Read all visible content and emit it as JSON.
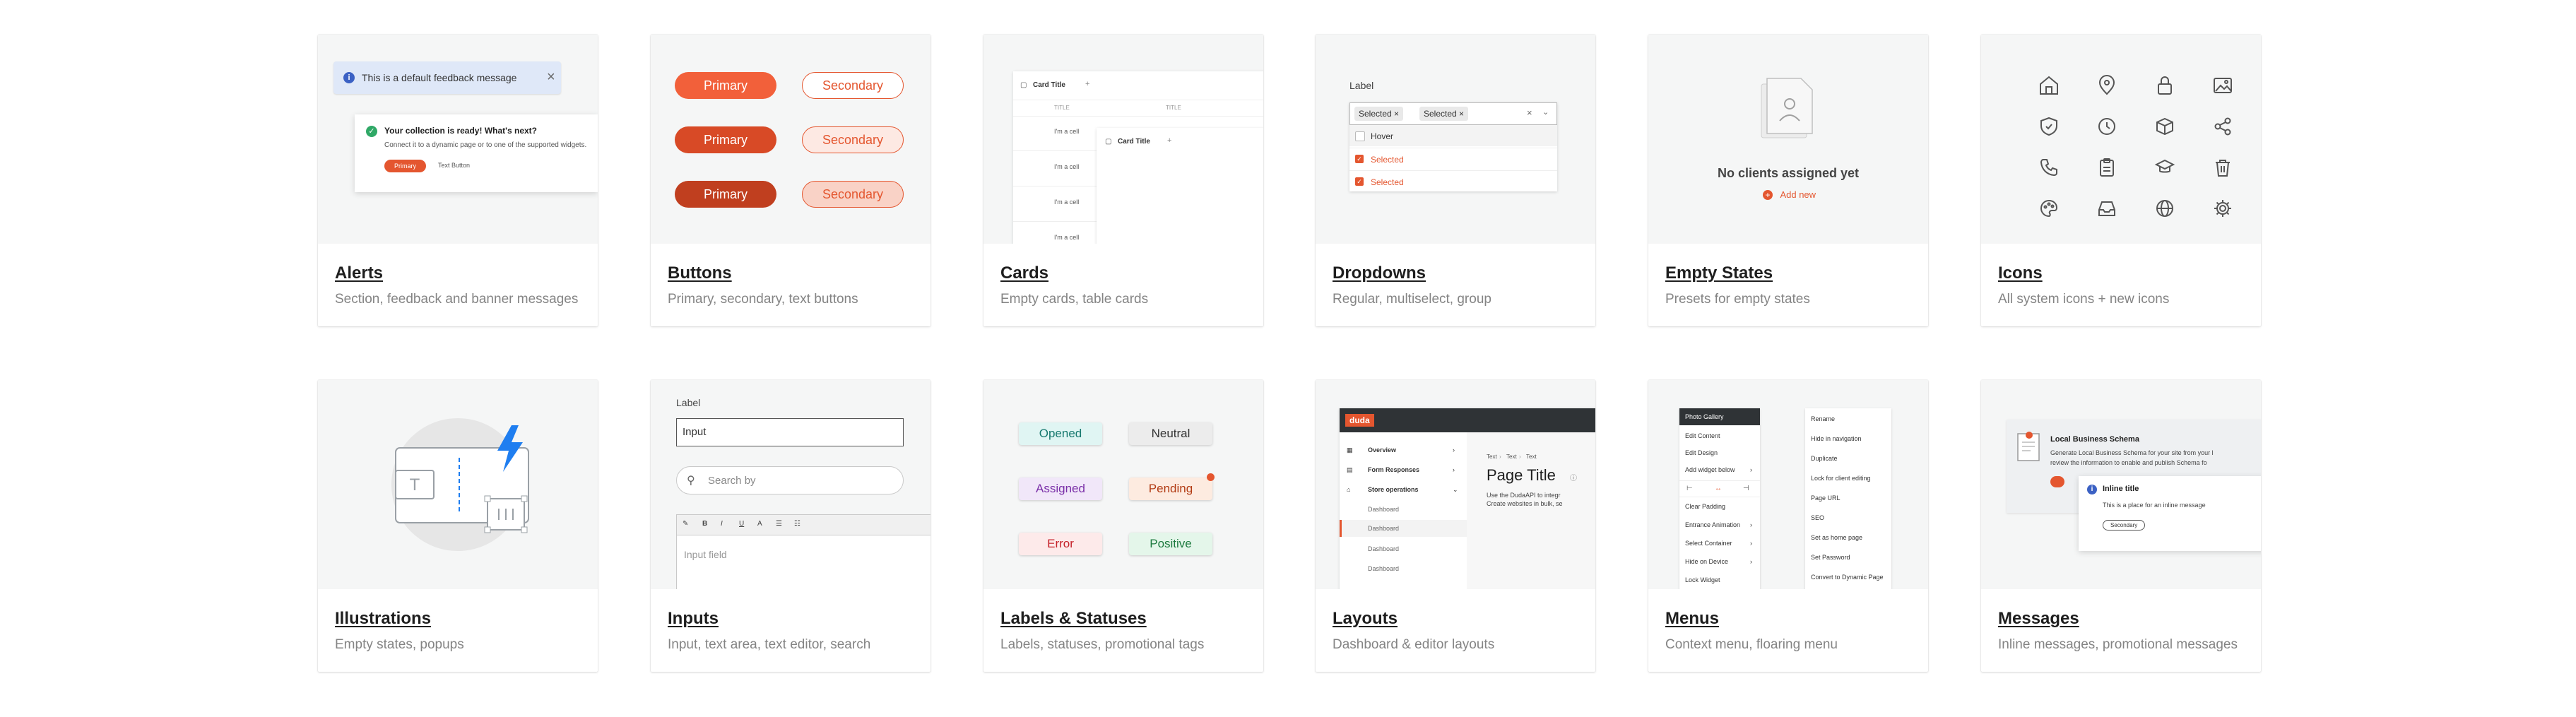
{
  "cards": [
    {
      "title": "Alerts",
      "desc": "Section, feedback and banner messages"
    },
    {
      "title": "Buttons",
      "desc": "Primary, secondary, text buttons"
    },
    {
      "title": "Cards",
      "desc": "Empty cards, table cards"
    },
    {
      "title": "Dropdowns",
      "desc": "Regular, multiselect, group"
    },
    {
      "title": "Empty States",
      "desc": "Presets for empty states"
    },
    {
      "title": "Icons",
      "desc": "All system icons + new icons"
    },
    {
      "title": "Illustrations",
      "desc": "Empty states, popups"
    },
    {
      "title": "Inputs",
      "desc": "Input, text area, text editor, search"
    },
    {
      "title": "Labels & Statuses",
      "desc": "Labels, statuses, promotional tags"
    },
    {
      "title": "Layouts",
      "desc": "Dashboard & editor layouts"
    },
    {
      "title": "Menus",
      "desc": "Context menu, floaring menu"
    },
    {
      "title": "Messages",
      "desc": "Inline messages, promotional messages"
    }
  ],
  "alerts": {
    "banner_text": "This is a default feedback message",
    "title": "Your collection is ready! What's next?",
    "body": "Connect it to a dynamic page or to one of the supported widgets.",
    "primary": "Primary",
    "text_button": "Text Button"
  },
  "buttons": {
    "primary": "Primary",
    "secondary": "Secondary"
  },
  "cards_preview": {
    "card_title": "Card Title",
    "col_title": "TITLE",
    "cell": "I'm a cell"
  },
  "dropdowns": {
    "label": "Label",
    "chip": "Selected",
    "hover": "Hover",
    "selected": "Selected"
  },
  "empty_states": {
    "title": "No clients assigned yet",
    "action": "Add new"
  },
  "inputs": {
    "label": "Label",
    "value": "Input",
    "search_placeholder": "Search by",
    "textarea_placeholder": "Input field"
  },
  "labels": {
    "opened": "Opened",
    "neutral": "Neutral",
    "assigned": "Assigned",
    "pending": "Pending",
    "error": "Error",
    "positive": "Positive"
  },
  "layouts": {
    "logo": "duda",
    "nav": [
      "Overview",
      "Form Responses",
      "Store operations",
      "Dashboard",
      "Dashboard",
      "Dashboard",
      "Dashboard"
    ],
    "breadcrumb": [
      "Text",
      "Text",
      "Text"
    ],
    "page_title": "Page Title",
    "desc1": "Use the DudaAPI to integr",
    "desc2": "Create websites in bulk, se"
  },
  "menus": {
    "left": [
      "Photo Gallery",
      "Edit Content",
      "Edit Design",
      "Add widget below",
      "Clear Padding",
      "Entrance Animation",
      "Select Container",
      "Hide on Device",
      "Lock Widget"
    ],
    "right": [
      "Rename",
      "Hide in navigation",
      "Duplicate",
      "Lock for client editing",
      "Page URL",
      "SEO",
      "Set as home page",
      "Set Password",
      "Convert to Dynamic Page"
    ]
  },
  "messages": {
    "promo_title": "Local Business Schema",
    "promo_body1": "Generate Local Business Schema for your site from your l",
    "promo_body2": "review the information to enable and publish Schema fo",
    "inline_title": "Inline title",
    "inline_body": "This is a place for an inline message",
    "secondary": "Secondary"
  },
  "colors": {
    "accent": "#e4562f",
    "info": "#3b61c4",
    "success": "#2fa866",
    "bolt": "#1f7ef0"
  }
}
